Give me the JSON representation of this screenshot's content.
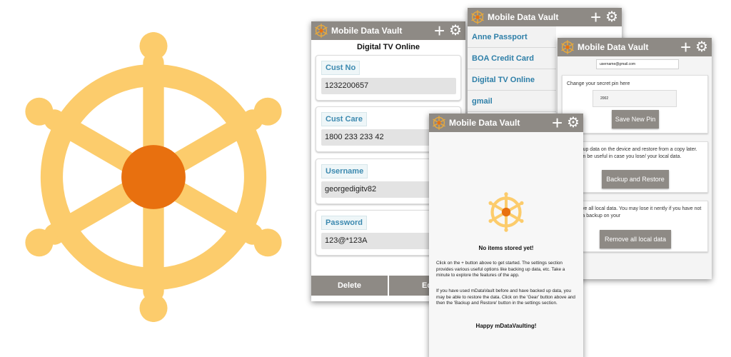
{
  "colors": {
    "wheel": "#fccc6c",
    "hub": "#e8700f",
    "appbar": "#8e8a85",
    "accent_text": "#3d8ab0"
  },
  "app": {
    "title": "Mobile Data Vault",
    "add_icon": "plus-icon",
    "settings_icon": "gear-icon"
  },
  "detail": {
    "title": "Digital TV Online",
    "fields": [
      {
        "label": "Cust No",
        "value": "1232200657"
      },
      {
        "label": "Cust Care",
        "value": "1800 233 233 42"
      },
      {
        "label": "Username",
        "value": "georgedigitv82"
      },
      {
        "label": "Password",
        "value": "123@*123A"
      }
    ],
    "delete_label": "Delete",
    "edit_label": "Ed"
  },
  "list": {
    "items": [
      "Anne Passport",
      "BOA Credit Card",
      "Digital TV Online",
      "gmail"
    ]
  },
  "settings": {
    "username": "username@gmail.com",
    "pin_prompt": "Change your secret pin here",
    "pin_value": "2002",
    "save_pin_label": "Save New Pin",
    "backup_text": "n back up data on the device and restore from a copy later. This can be useful in case you lose/ your local data.",
    "backup_label": "Backup and Restore",
    "remove_text": "ll remove all local data. You may lose it nently if you have not stored a backup on your",
    "remove_label": "Remove all local data"
  },
  "empty": {
    "title": "No items stored yet!",
    "para1": "Click on the + button above to get started. The settings section provides various useful options like backing up data, etc. Take a minute to explore the features of the app.",
    "para2": "If you have used mDataVault before and have backed up data, you may be able to restore the data. Click on the 'Gear' button above and then the 'Backup and Restore' button in the settings section.",
    "happy": "Happy mDataVaulting!"
  }
}
